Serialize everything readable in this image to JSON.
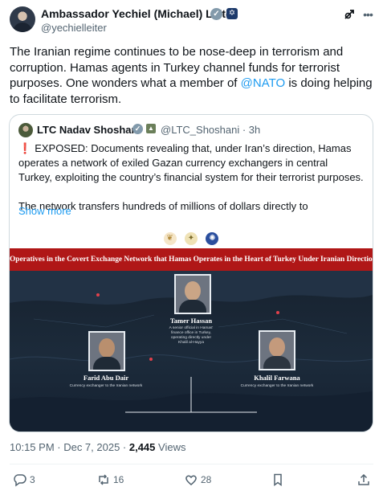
{
  "author": {
    "name": "Ambassador Yechiel (Michael) Leiter",
    "handle": "@yechielleiter"
  },
  "tweet": {
    "text_before": "The Iranian regime continues to be nose-deep in terrorism and corruption. Hamas agents in Turkey channel funds for terrorist purposes. One wonders what a member of ",
    "mention": "@NATO",
    "text_after": " is doing helping to facilitate terrorism."
  },
  "quote": {
    "name": "LTC Nadav Shoshani",
    "handle": "@LTC_Shoshani",
    "time": "3h",
    "paragraph1": "EXPOSED: Documents revealing that, under Iran’s direction, Hamas operates a network of exiled Gazan currency exchangers in central Turkey, exploiting the country’s financial system for their terrorist purposes.",
    "paragraph2": "The network transfers hundreds of millions of dollars directly to",
    "show_more": "Show more",
    "image": {
      "banner": "Operatives in the Covert Exchange Network that Hamas Operates in the Heart of Turkey Under Iranian Direction",
      "people": [
        {
          "name": "Tamer Hassan",
          "desc": "A senior official in Hamas' finance office in Turkey, operating directly under Khalil al-Hayya"
        },
        {
          "name": "Farid Abu Dair",
          "desc": "Currency exchanger to the Iranian network"
        },
        {
          "name": "Khalil Farwana",
          "desc": "Currency exchanger to the Iranian network"
        }
      ]
    }
  },
  "meta": {
    "time": "10:15 PM · Dec 7, 2025 · ",
    "views_count": "2,445",
    "views_label": " Views"
  },
  "actions": {
    "replies": "3",
    "reposts": "16",
    "likes": "28"
  },
  "colors": {
    "accent": "#1d9bf0",
    "banner_red": "#b01717",
    "map_bg": "#1c2b3b"
  }
}
